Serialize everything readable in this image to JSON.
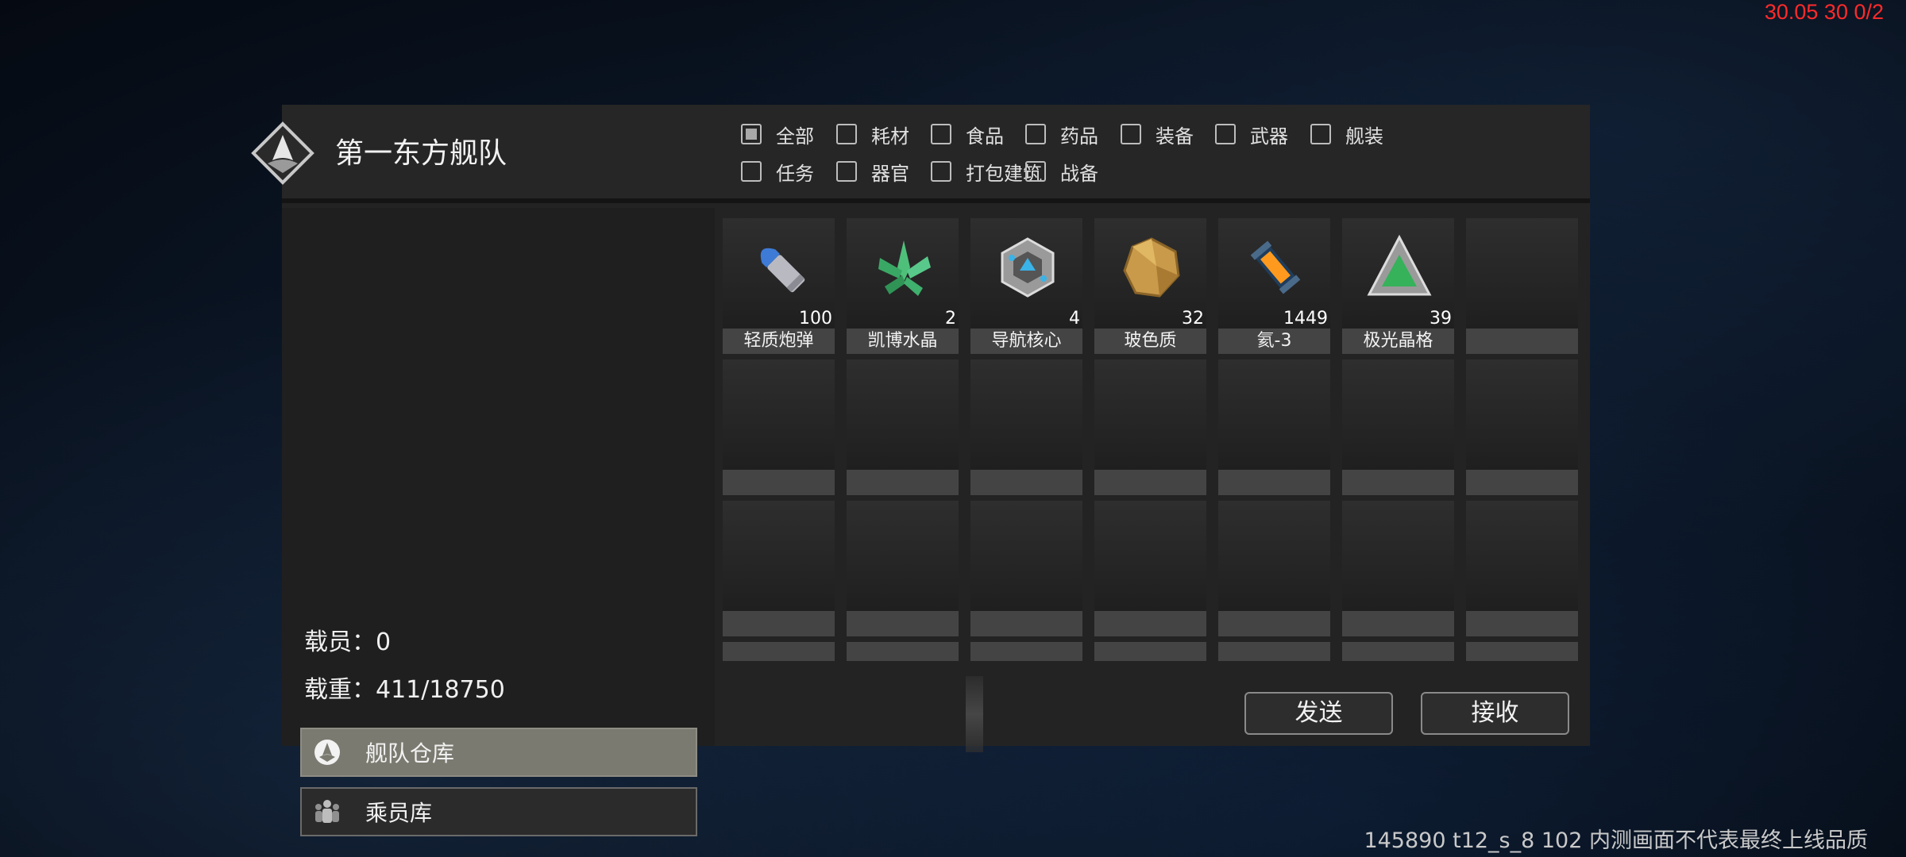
{
  "debug": {
    "top_right": "30.05 30 0/2",
    "bottom_right": "145890 t12_s_8 102  内测画面不代表最终上线品质"
  },
  "fleet": {
    "name": "第一东方舰队",
    "logo": "fleet-emblem-icon"
  },
  "filters": [
    {
      "label": "全部",
      "checked": true
    },
    {
      "label": "耗材",
      "checked": false
    },
    {
      "label": "食品",
      "checked": false
    },
    {
      "label": "药品",
      "checked": false
    },
    {
      "label": "装备",
      "checked": false
    },
    {
      "label": "武器",
      "checked": false
    },
    {
      "label": "舰装",
      "checked": false
    },
    {
      "label": "任务",
      "checked": false
    },
    {
      "label": "器官",
      "checked": false
    },
    {
      "label": "打包建筑",
      "checked": false
    },
    {
      "label": "战备",
      "checked": false
    }
  ],
  "stats": {
    "crew": "载员：0",
    "load": "载重：411/18750"
  },
  "tabs": [
    {
      "label": "舰队仓库",
      "icon": "warehouse-icon",
      "active": true
    },
    {
      "label": "乘员库",
      "icon": "crew-icon",
      "active": false
    }
  ],
  "items": [
    {
      "name": "轻质炮弹",
      "qty": "100",
      "icon": "light-shell-icon"
    },
    {
      "name": "凯博水晶",
      "qty": "2",
      "icon": "green-crystal-icon"
    },
    {
      "name": "导航核心",
      "qty": "4",
      "icon": "nav-core-icon"
    },
    {
      "name": "玻色质",
      "qty": "32",
      "icon": "boson-icon"
    },
    {
      "name": "氦-3",
      "qty": "1449",
      "icon": "helium3-canister-icon"
    },
    {
      "name": "极光晶格",
      "qty": "39",
      "icon": "aurora-lattice-icon"
    },
    {
      "name": "",
      "qty": "",
      "icon": ""
    }
  ],
  "buttons": {
    "send": "发送",
    "receive": "接收"
  },
  "colors": {
    "accent_tab": "#7b7a70",
    "panel": "#232323",
    "debug_red": "#ff2a2a"
  }
}
